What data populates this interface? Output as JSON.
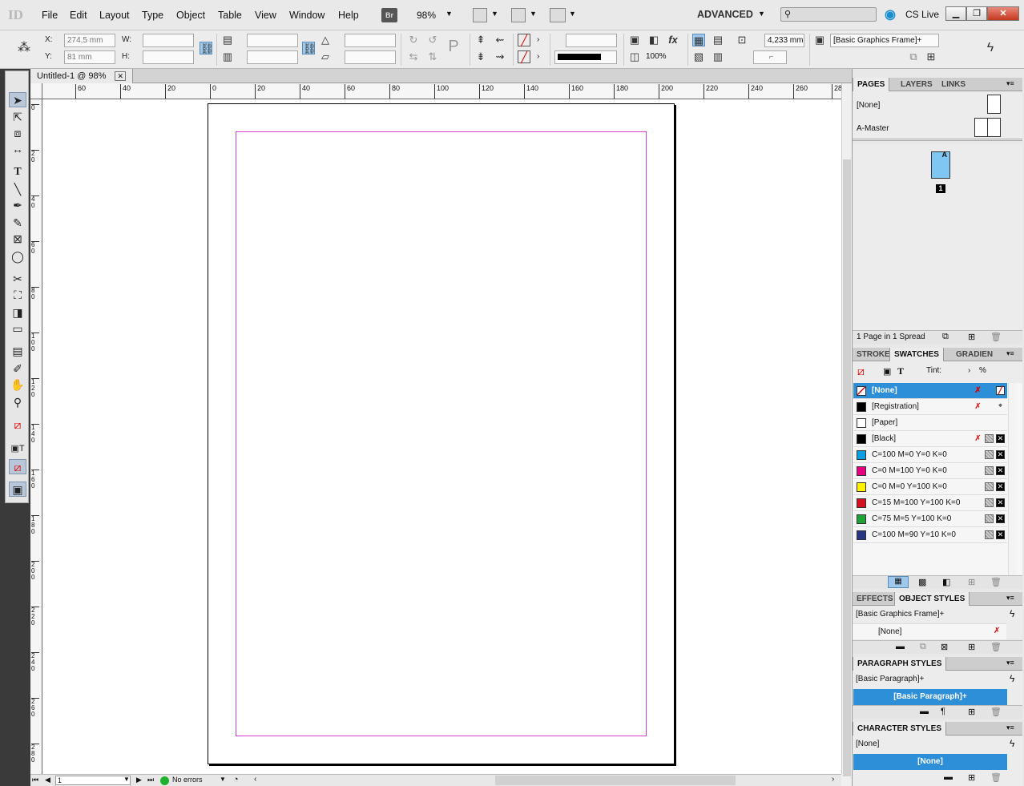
{
  "menubar": {
    "app_logo": "ID",
    "items": [
      "File",
      "Edit",
      "Layout",
      "Type",
      "Object",
      "Table",
      "View",
      "Window",
      "Help"
    ],
    "bridge": "Br",
    "zoom": "98%",
    "workspace": "ADVANCED",
    "cs_live": "CS Live"
  },
  "control": {
    "x_label": "X:",
    "x_value": "274,5 mm",
    "y_label": "Y:",
    "y_value": "81 mm",
    "w_label": "W:",
    "h_label": "H:",
    "stroke_weight": "4,233 mm",
    "opacity": "100%",
    "object_style": "[Basic Graphics Frame]+"
  },
  "document": {
    "tab_title": "Untitled-1 @ 98%",
    "hruler_labels": [
      "60",
      "40",
      "20",
      "0",
      "20",
      "40",
      "60",
      "80",
      "100",
      "120",
      "140",
      "160",
      "180",
      "200",
      "220",
      "240",
      "260",
      "28"
    ],
    "vruler_labels": [
      "0",
      "2 0",
      "4 0",
      "6 0",
      "8 0",
      "1 0 0",
      "1 2 0",
      "1 4 0",
      "1 6 0",
      "1 8 0",
      "2 0 0",
      "2 2 0",
      "2 4 0",
      "2 6 0",
      "2 8 0"
    ]
  },
  "statusbar": {
    "page_number": "1",
    "preflight": "No errors"
  },
  "pages_panel": {
    "tabs": [
      "PAGES",
      "LAYERS",
      "LINKS"
    ],
    "masters": [
      "[None]",
      "A-Master"
    ],
    "page_label": "A",
    "page_number": "1",
    "footer": "1 Page in 1 Spread"
  },
  "swatches_panel": {
    "tabs": [
      "STROKE",
      "SWATCHES",
      "GRADIEN"
    ],
    "tint_label": "Tint:",
    "tint_unit": "%",
    "swatches": [
      {
        "name": "[None]",
        "color": "#ffffff"
      },
      {
        "name": "[Registration]",
        "color": "#000000"
      },
      {
        "name": "[Paper]",
        "color": "#ffffff"
      },
      {
        "name": "[Black]",
        "color": "#000000"
      },
      {
        "name": "C=100 M=0 Y=0 K=0",
        "color": "#0aa0e0"
      },
      {
        "name": "C=0 M=100 Y=0 K=0",
        "color": "#e4007f"
      },
      {
        "name": "C=0 M=0 Y=100 K=0",
        "color": "#fff200"
      },
      {
        "name": "C=15 M=100 Y=100 K=0",
        "color": "#d2121f"
      },
      {
        "name": "C=75 M=5 Y=100 K=0",
        "color": "#1fa23a"
      },
      {
        "name": "C=100 M=90 Y=10 K=0",
        "color": "#283583"
      }
    ]
  },
  "object_styles_panel": {
    "tabs": [
      "EFFECTS",
      "OBJECT STYLES"
    ],
    "current": "[Basic Graphics Frame]+",
    "items": [
      "[None]"
    ]
  },
  "paragraph_styles_panel": {
    "title": "PARAGRAPH STYLES",
    "current": "[Basic Paragraph]+",
    "selected": "[Basic Paragraph]+"
  },
  "character_styles_panel": {
    "title": "CHARACTER STYLES",
    "current": "[None]",
    "selected": "[None]"
  },
  "colors": {
    "selection": "#2e8fd9",
    "margin": "#d43fd0"
  }
}
